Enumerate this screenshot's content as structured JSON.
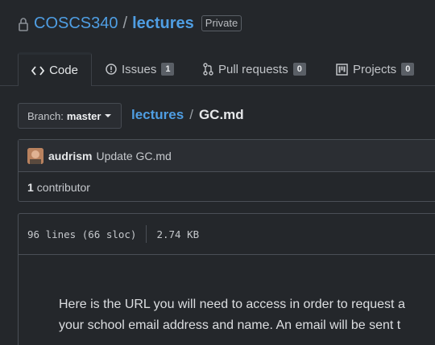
{
  "repo": {
    "owner": "COSCS340",
    "separator": "/",
    "name": "lectures",
    "visibility": "Private"
  },
  "tabs": [
    {
      "label": "Code",
      "icon": "code-icon"
    },
    {
      "label": "Issues",
      "icon": "issue-icon",
      "count": "1"
    },
    {
      "label": "Pull requests",
      "icon": "pull-request-icon",
      "count": "0"
    },
    {
      "label": "Projects",
      "icon": "project-icon",
      "count": "0"
    }
  ],
  "branch": {
    "prefix": "Branch:",
    "name": "master"
  },
  "breadcrumb": {
    "repo": "lectures",
    "separator": "/",
    "file": "GC.md"
  },
  "commit": {
    "author": "audrism",
    "message": "Update GC.md"
  },
  "contributors": {
    "count": "1",
    "label": "contributor"
  },
  "file": {
    "lines": "96 lines (66 sloc)",
    "size": "2.74 KB"
  },
  "content": {
    "line1": "Here is the URL you will need to access in order to request a",
    "line2": "your school email address and name. An email will be sent t"
  },
  "colors": {
    "link": "#4f9ee3",
    "background": "#24272b"
  }
}
